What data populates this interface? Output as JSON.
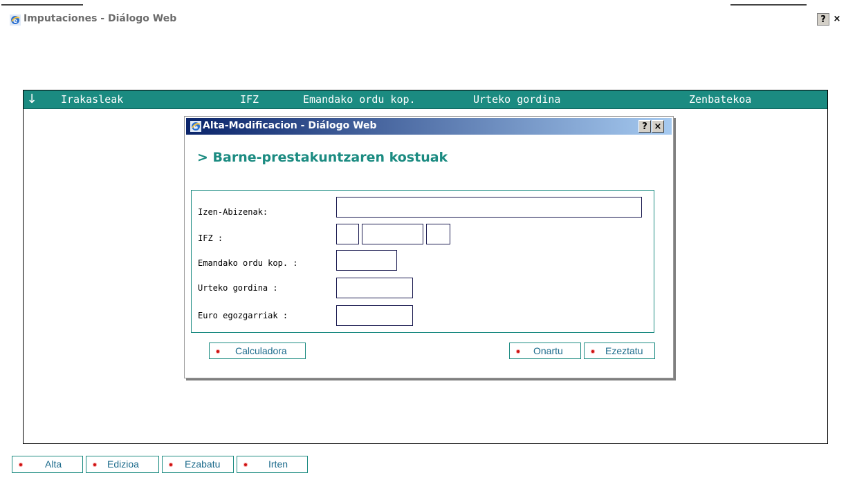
{
  "window": {
    "title": "Imputaciones - Diálogo Web",
    "help_label": "?",
    "close_label": "×"
  },
  "grid": {
    "sort_icon": "↓",
    "columns": [
      "Irakasleak",
      "IFZ",
      "Emandako ordu kop.",
      "Urteko gordina",
      "Zenbatekoa"
    ]
  },
  "bottom_buttons": [
    "Alta",
    "Edizioa",
    "Ezabatu",
    "Irten"
  ],
  "dialog": {
    "title": "Alta-Modificacion - Diálogo Web",
    "help_label": "?",
    "close_label": "×",
    "heading": "> Barne-prestakuntzaren kostuak",
    "fields": {
      "name_label": "Izen-Abizenak:",
      "name_value": "",
      "ifz_label": "IFZ :",
      "ifz_part1": "",
      "ifz_part2": "",
      "ifz_part3": "",
      "hours_label": "Emandako ordu kop. :",
      "hours_value": "",
      "gross_label": "Urteko gordina :",
      "gross_value": "",
      "euro_label": "Euro egozgarriak :",
      "euro_value": ""
    },
    "buttons": {
      "calculator": "Calculadora",
      "accept": "Onartu",
      "cancel": "Ezeztatu"
    }
  },
  "colors": {
    "accent": "#1b8b81",
    "title_bar_start": "#0a246a",
    "title_bar_end": "#a6caf0",
    "bullet": "#cc1111"
  },
  "icons": {
    "window": "ie-icon",
    "sort": "arrow-down-icon",
    "bullet": "red-dot-icon"
  }
}
